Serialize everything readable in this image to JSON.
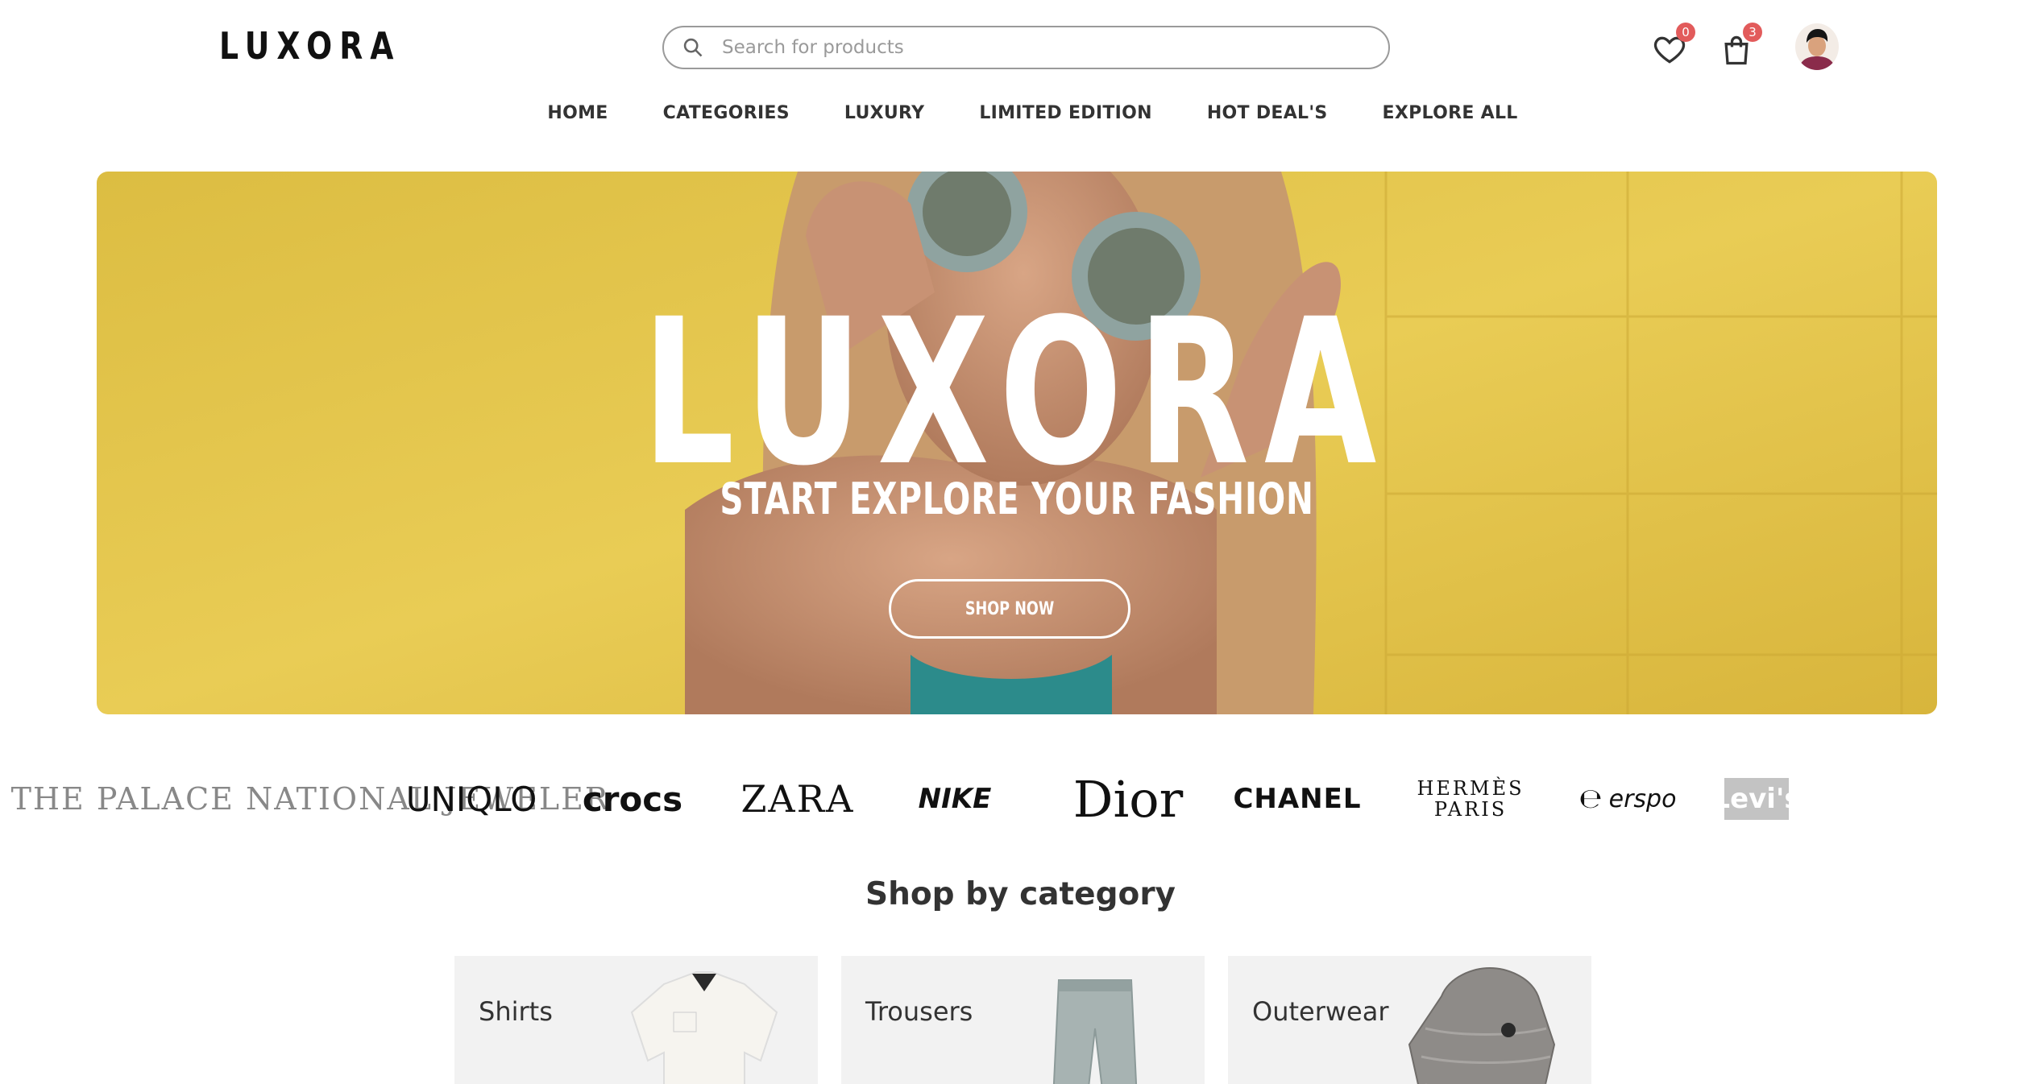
{
  "header": {
    "logo": "LUXORA",
    "search_placeholder": "Search for products",
    "wishlist_count": "0",
    "cart_count": "3"
  },
  "nav": {
    "items": [
      "HOME",
      "CATEGORIES",
      "LUXURY",
      "LIMITED EDITION",
      "HOT DEAL'S",
      "EXPLORE ALL"
    ]
  },
  "hero": {
    "title": "LUXORA",
    "subtitle": "START EXPLORE YOUR FASHION",
    "cta": "SHOP NOW"
  },
  "brands": [
    "THE PALACE NATIONAL JEWELER",
    "UNIQLO",
    "crocs",
    "ZARA",
    "NIKE",
    "Dior",
    "CHANEL",
    "HERMÈS PARIS",
    "erspo",
    "Levi's"
  ],
  "categories": {
    "title": "Shop by category",
    "items": [
      "Shirts",
      "Trousers",
      "Outerwear"
    ]
  },
  "colors": {
    "hero_yellow": "#e7c53f",
    "badge_red": "#e25b5b"
  }
}
